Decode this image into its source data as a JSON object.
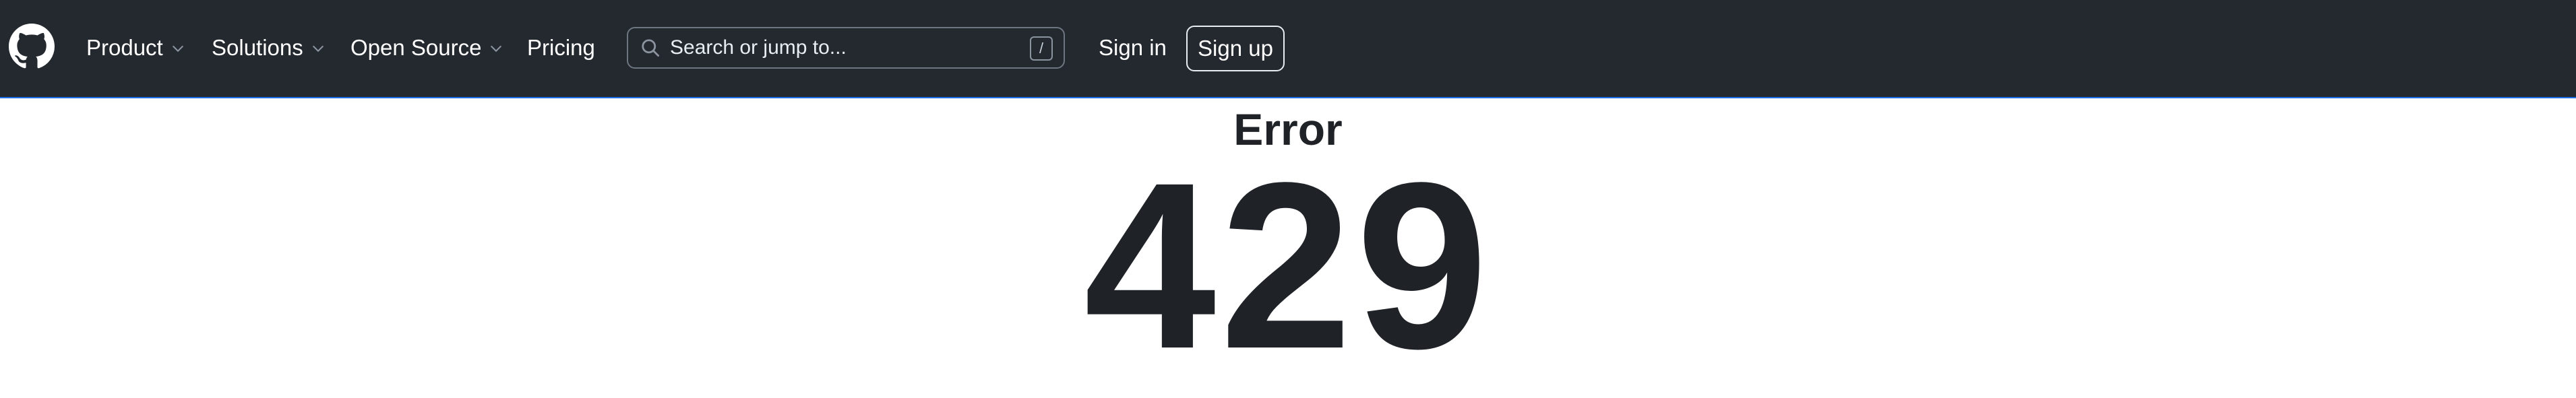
{
  "header": {
    "logo_icon": "github-mark-icon",
    "nav": [
      {
        "label": "Product",
        "has_dropdown": true
      },
      {
        "label": "Solutions",
        "has_dropdown": true
      },
      {
        "label": "Open Source",
        "has_dropdown": true
      },
      {
        "label": "Pricing",
        "has_dropdown": false
      }
    ],
    "search": {
      "placeholder": "Search or jump to...",
      "shortcut": "/",
      "icon": "search-icon"
    },
    "sign_in": "Sign in",
    "sign_up": "Sign up",
    "colors": {
      "background": "#24292f",
      "accent_border": "#1f6feb"
    }
  },
  "main": {
    "title": "Error",
    "code": "429"
  }
}
